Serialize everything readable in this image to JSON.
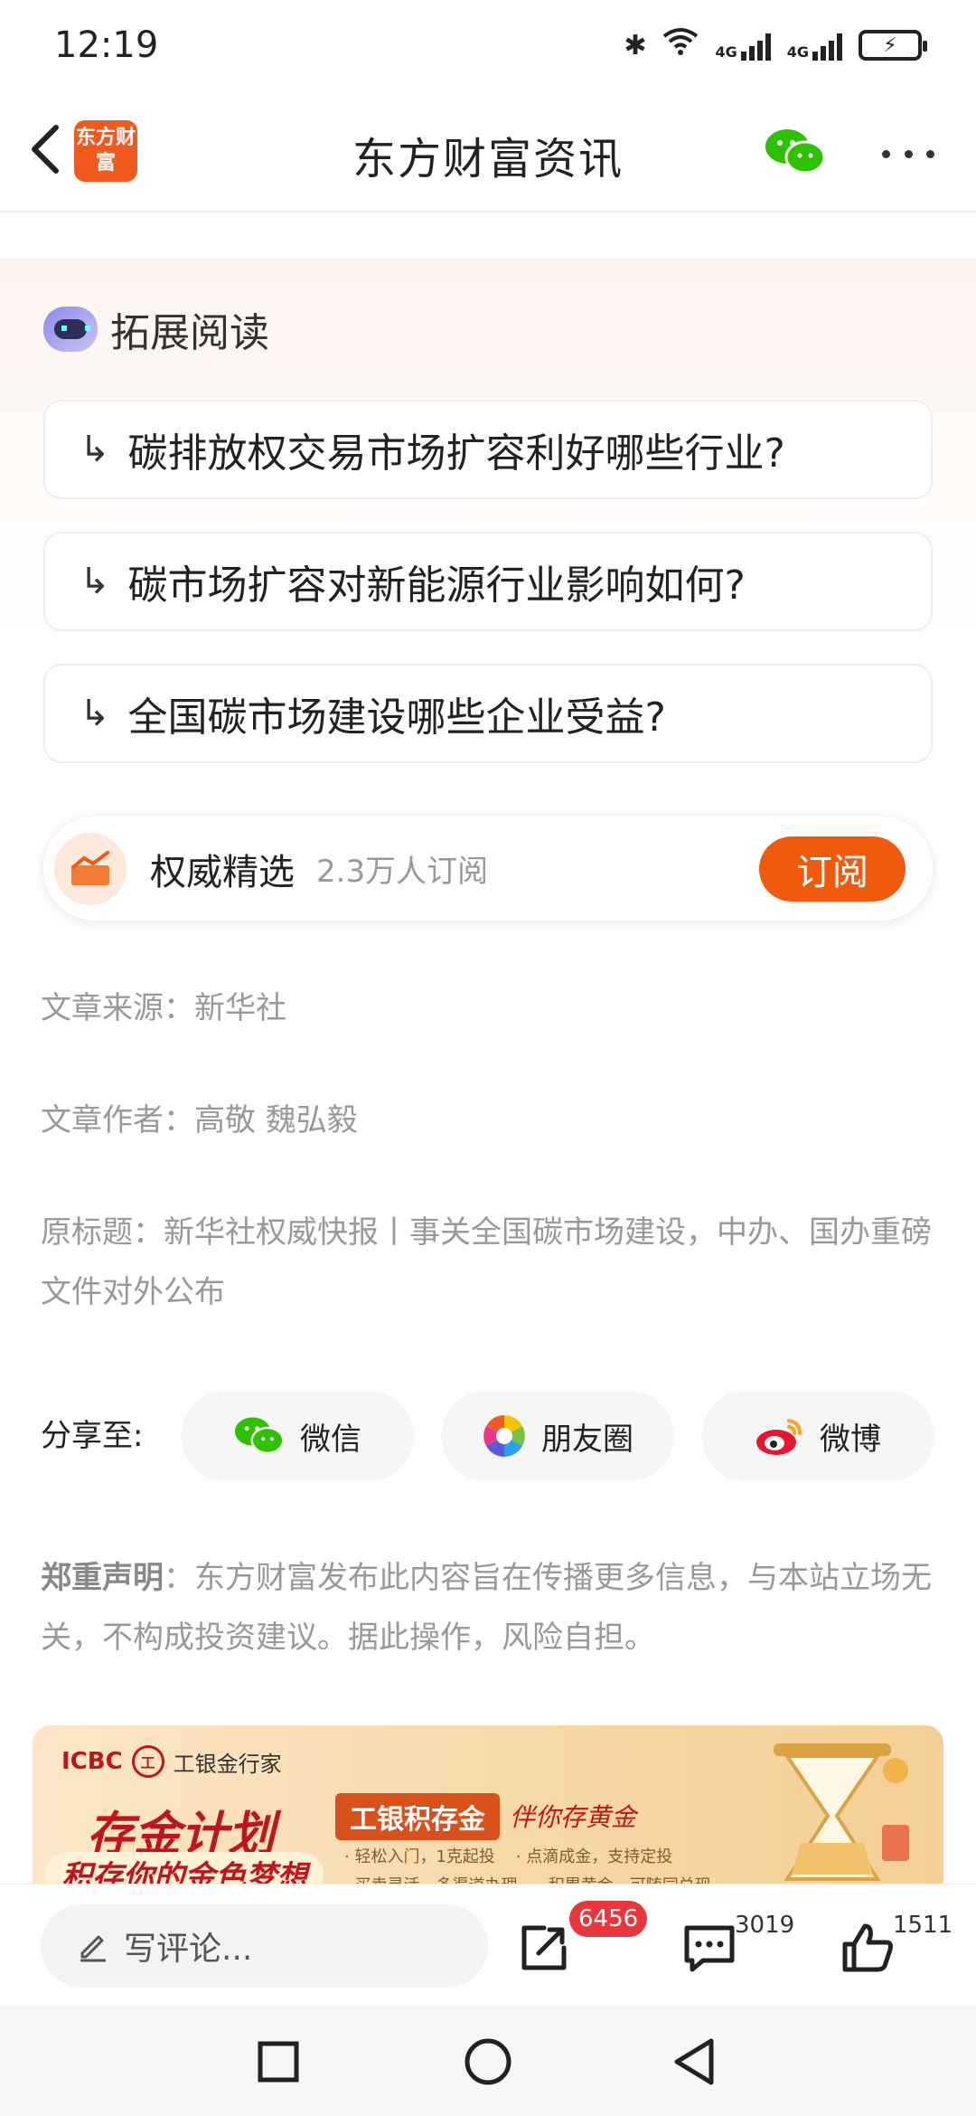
{
  "status_bar": {
    "time": "12:19",
    "net1": "4G",
    "net2": "4G"
  },
  "header": {
    "logo_text": "东方财富",
    "title": "东方财富资讯"
  },
  "extended_reading": {
    "title": "拓展阅读",
    "arrow": "↳",
    "questions": [
      "碳排放权交易市场扩容利好哪些行业?",
      "碳市场扩容对新能源行业影响如何?",
      "全国碳市场建设哪些企业受益?"
    ]
  },
  "subscribe": {
    "name": "权威精选",
    "count": "2.3万人订阅",
    "button": "订阅"
  },
  "meta": {
    "source": "文章来源：新华社",
    "author": "文章作者：高敬 魏弘毅",
    "original_title": "原标题：新华社权威快报丨事关全国碳市场建设，中办、国办重磅文件对外公布"
  },
  "share": {
    "label": "分享至:",
    "wechat": "微信",
    "moments": "朋友圈",
    "weibo": "微博"
  },
  "disclaimer": {
    "bold": "郑重声明",
    "text": "：东方财富发布此内容旨在传播更多信息，与本站立场无关，不构成投资建议。据此操作，风险自担。"
  },
  "ad": {
    "brand": "ICBC",
    "brand_sub": "工银金行家",
    "headline": "存金计划",
    "dream": "积存你的金色梦想",
    "tag": "工银积存金",
    "slogan": "伴你存黄金",
    "bullets": "· 轻松入门，1克起投    · 点滴成金，支持定投\n· 买卖灵活，多渠道办理    · 积累黄金，可随同兑现"
  },
  "action_bar": {
    "comment_placeholder": "写评论...",
    "share_count": "6456",
    "comment_count": "3019",
    "like_count": "1511"
  },
  "colors": {
    "accent": "#f05a0c",
    "badge": "#e8363d",
    "muted_text": "#999999"
  }
}
